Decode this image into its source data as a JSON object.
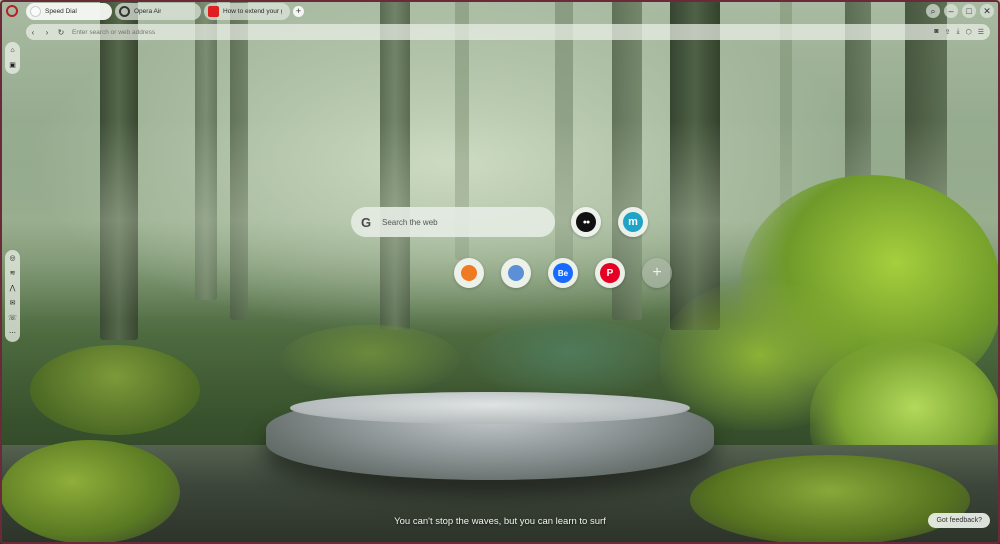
{
  "browser": {
    "tabs": [
      {
        "label": "Speed Dial",
        "icon": "speed-dial-icon",
        "active": true
      },
      {
        "label": "Opera Air",
        "icon": "opera-air-icon",
        "active": false
      },
      {
        "label": "How to extend your ga",
        "icon": "youtube-icon",
        "active": false
      }
    ],
    "new_tab": "+",
    "address_placeholder": "Enter search or web address"
  },
  "search": {
    "placeholder": "Search the web",
    "engine_icon": "G"
  },
  "speed_dial": {
    "top_row": [
      {
        "name": "medium",
        "glyph": "●●",
        "color": "#111111"
      },
      {
        "name": "miro",
        "glyph": "m",
        "color": "#1fa3c7"
      }
    ],
    "bottom_row": [
      {
        "name": "orange-site",
        "glyph": "",
        "color": "#f07a21"
      },
      {
        "name": "blue-site",
        "glyph": "",
        "color": "#5b8fd6"
      },
      {
        "name": "behance",
        "glyph": "Be",
        "color": "#1769ff"
      },
      {
        "name": "pinterest",
        "glyph": "P",
        "color": "#e60023"
      }
    ],
    "add": "+"
  },
  "quote": "You can't stop the waves, but you can learn to surf",
  "feedback": "Got feedback?"
}
